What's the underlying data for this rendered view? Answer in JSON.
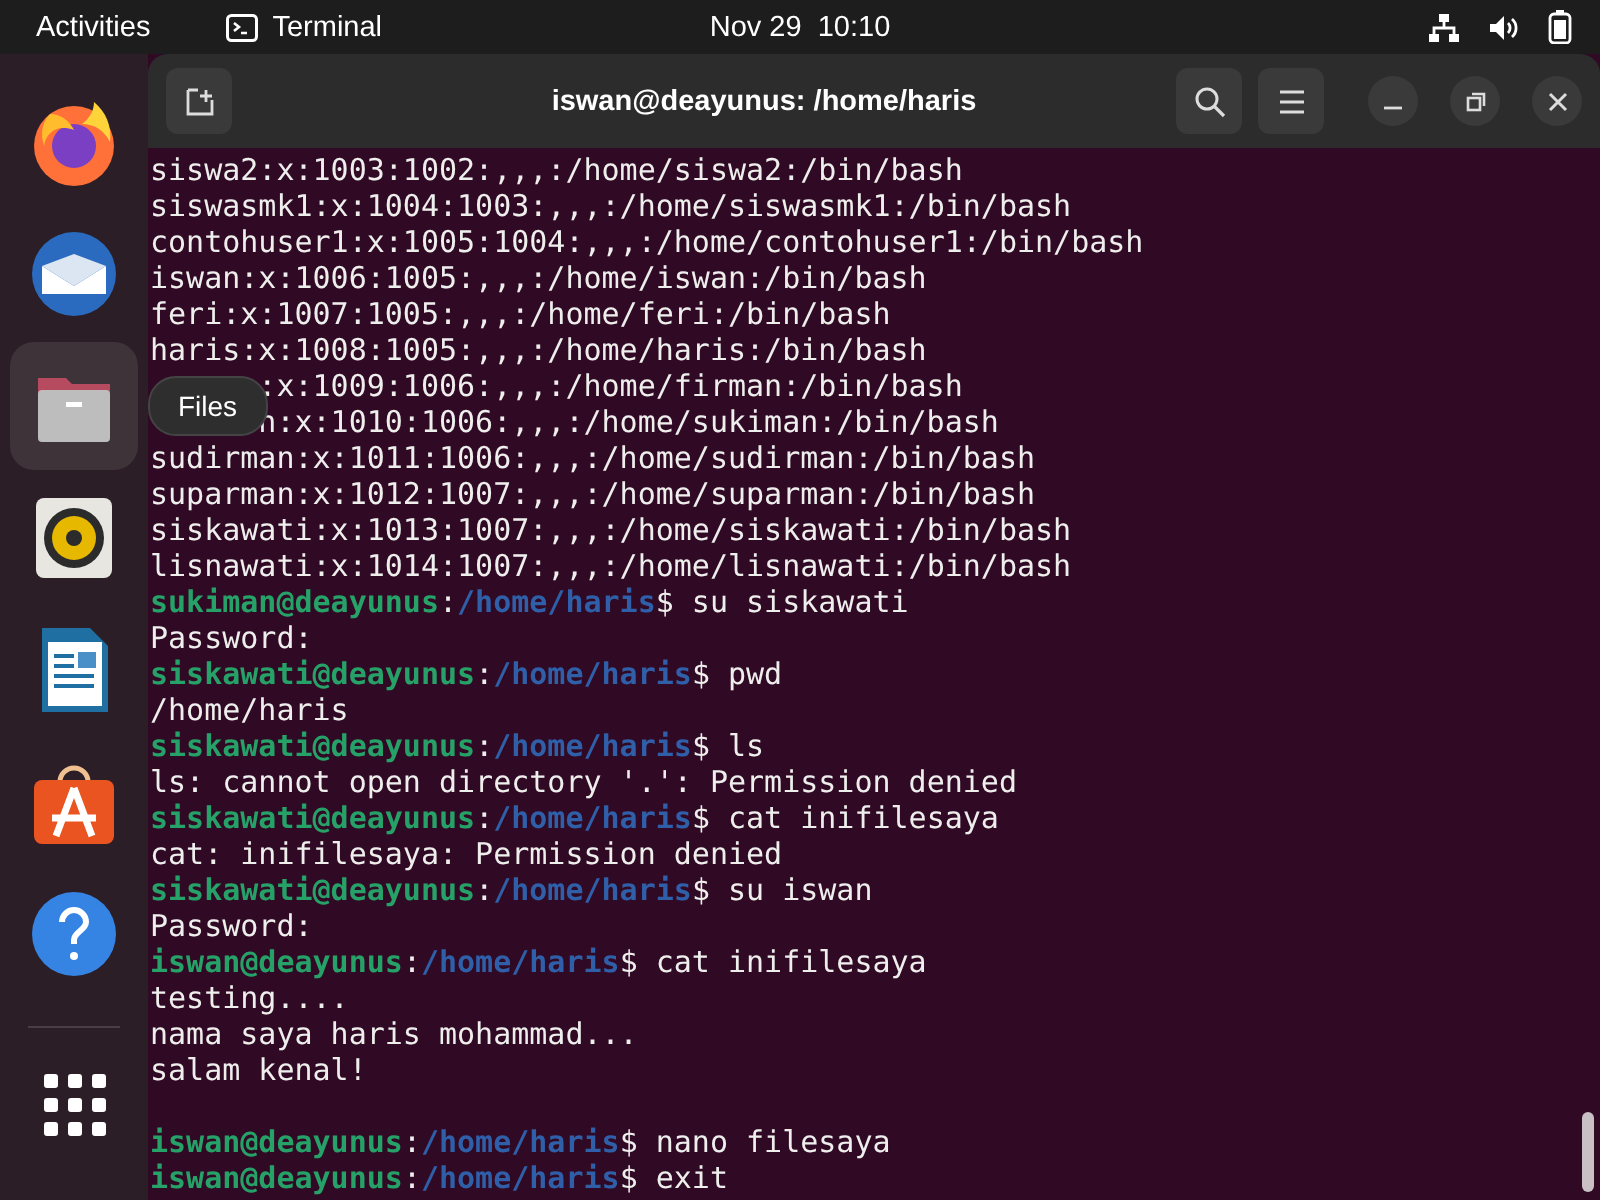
{
  "top_bar": {
    "activities": "Activities",
    "app_menu": "Terminal",
    "clock": "Nov 29  10:10"
  },
  "dock": {
    "items": [
      {
        "kind": "browser",
        "selected": false
      },
      {
        "kind": "mail",
        "selected": false
      },
      {
        "kind": "files",
        "selected": true
      },
      {
        "kind": "music",
        "selected": false
      },
      {
        "kind": "document",
        "selected": false
      },
      {
        "kind": "store",
        "selected": false
      },
      {
        "kind": "help",
        "selected": false
      }
    ],
    "tooltip": "Files"
  },
  "window": {
    "title": "iswan@deayunus: /home/haris"
  },
  "terminal": {
    "lines": [
      {
        "kind": "output",
        "text": "siswa2:x:1003:1002:,,,:/home/siswa2:/bin/bash"
      },
      {
        "kind": "output",
        "text": "siswasmk1:x:1004:1003:,,,:/home/siswasmk1:/bin/bash"
      },
      {
        "kind": "output",
        "text": "contohuser1:x:1005:1004:,,,:/home/contohuser1:/bin/bash"
      },
      {
        "kind": "output",
        "text": "iswan:x:1006:1005:,,,:/home/iswan:/bin/bash"
      },
      {
        "kind": "output",
        "text": "feri:x:1007:1005:,,,:/home/feri:/bin/bash"
      },
      {
        "kind": "output",
        "text": "haris:x:1008:1005:,,,:/home/haris:/bin/bash"
      },
      {
        "kind": "covered",
        "tail": ":x:1009:1006:,,,:/home/firman:/bin/bash"
      },
      {
        "kind": "covered",
        "tail": "n:x:1010:1006:,,,:/home/sukiman:/bin/bash"
      },
      {
        "kind": "output",
        "text": "sudirman:x:1011:1006:,,,:/home/sudirman:/bin/bash"
      },
      {
        "kind": "output",
        "text": "suparman:x:1012:1007:,,,:/home/suparman:/bin/bash"
      },
      {
        "kind": "output",
        "text": "siskawati:x:1013:1007:,,,:/home/siskawati:/bin/bash"
      },
      {
        "kind": "output",
        "text": "lisnawati:x:1014:1007:,,,:/home/lisnawati:/bin/bash"
      },
      {
        "kind": "prompt",
        "user": "sukiman@deayunus",
        "sep": ":",
        "path": "/home/haris",
        "command": "$ su siskawati"
      },
      {
        "kind": "output",
        "text": "Password:"
      },
      {
        "kind": "prompt",
        "user": "siskawati@deayunus",
        "sep": ":",
        "path": "/home/haris",
        "command": "$ pwd"
      },
      {
        "kind": "output",
        "text": "/home/haris"
      },
      {
        "kind": "prompt",
        "user": "siskawati@deayunus",
        "sep": ":",
        "path": "/home/haris",
        "command": "$ ls"
      },
      {
        "kind": "output",
        "text": "ls: cannot open directory '.': Permission denied"
      },
      {
        "kind": "prompt",
        "user": "siskawati@deayunus",
        "sep": ":",
        "path": "/home/haris",
        "command": "$ cat inifilesaya"
      },
      {
        "kind": "output",
        "text": "cat: inifilesaya: Permission denied"
      },
      {
        "kind": "prompt",
        "user": "siskawati@deayunus",
        "sep": ":",
        "path": "/home/haris",
        "command": "$ su iswan"
      },
      {
        "kind": "output",
        "text": "Password:"
      },
      {
        "kind": "prompt",
        "user": "iswan@deayunus",
        "sep": ":",
        "path": "/home/haris",
        "command": "$ cat inifilesaya"
      },
      {
        "kind": "output",
        "text": "testing...."
      },
      {
        "kind": "output",
        "text": "nama saya haris mohammad..."
      },
      {
        "kind": "output",
        "text": "salam kenal!"
      },
      {
        "kind": "blank"
      },
      {
        "kind": "prompt",
        "user": "iswan@deayunus",
        "sep": ":",
        "path": "/home/haris",
        "command": "$ nano filesaya"
      },
      {
        "kind": "prompt",
        "user": "iswan@deayunus",
        "sep": ":",
        "path": "/home/haris",
        "command": "$ exit"
      }
    ]
  }
}
